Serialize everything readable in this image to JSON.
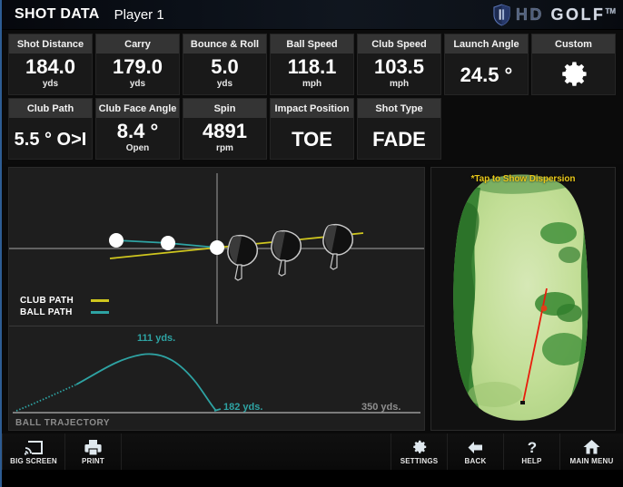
{
  "header": {
    "title": "SHOT DATA",
    "player": "Player 1",
    "logo_hd": "HD",
    "logo_golf": "GOLF",
    "logo_tm": "TM",
    "shield_icon": "shield-icon"
  },
  "stats": {
    "row1": [
      {
        "label": "Shot Distance",
        "value": "184.0",
        "unit": "yds"
      },
      {
        "label": "Carry",
        "value": "179.0",
        "unit": "yds"
      },
      {
        "label": "Bounce & Roll",
        "value": "5.0",
        "unit": "yds"
      },
      {
        "label": "Ball Speed",
        "value": "118.1",
        "unit": "mph"
      },
      {
        "label": "Club Speed",
        "value": "103.5",
        "unit": "mph"
      },
      {
        "label": "Launch Angle",
        "value": "24.5 °",
        "unit": ""
      },
      {
        "label": "Custom",
        "value": "",
        "unit": "",
        "icon": "gear-icon"
      }
    ],
    "row2": [
      {
        "label": "Club Path",
        "value": "5.5 ° O>I",
        "unit": ""
      },
      {
        "label": "Club Face Angle",
        "value": "8.4 °",
        "unit": "Open"
      },
      {
        "label": "Spin",
        "value": "4891",
        "unit": "rpm"
      },
      {
        "label": "Impact Position",
        "value": "TOE",
        "unit": ""
      },
      {
        "label": "Shot Type",
        "value": "FADE",
        "unit": ""
      }
    ]
  },
  "club_path_panel": {
    "legend": [
      {
        "label": "CLUB PATH",
        "color": "#cfc61e"
      },
      {
        "label": "BALL PATH",
        "color": "#2ea3a3"
      }
    ]
  },
  "chart_data": {
    "type": "line",
    "title": "BALL TRAJECTORY",
    "xlabel": "",
    "ylabel": "",
    "xlim": [
      0,
      350
    ],
    "ylim": [
      0,
      140
    ],
    "x_axis_end_label": "350 yds.",
    "series": [
      {
        "name": "Ball Trajectory",
        "color": "#2ea3a3",
        "x": [
          0,
          10,
          20,
          30,
          40,
          50,
          60,
          70,
          80,
          90,
          100,
          111,
          120,
          130,
          140,
          150,
          160,
          170,
          179,
          182
        ],
        "y": [
          0,
          14,
          26,
          38,
          48,
          57,
          65,
          72,
          78,
          83,
          86,
          88,
          87,
          84,
          78,
          68,
          53,
          33,
          6,
          3
        ]
      }
    ],
    "annotations": [
      {
        "text": "111 yds.",
        "x": 111,
        "y": 88,
        "color": "#2ea3a3",
        "meaning": "apex-height-label"
      },
      {
        "text": "182 yds.",
        "x": 182,
        "y": 3,
        "color": "#2ea3a3",
        "meaning": "landing-distance-label"
      }
    ],
    "grid": false,
    "legend_position": "none"
  },
  "green_view": {
    "tap_note": "*Tap to Show Dispersion",
    "shot_line_color": "#e81c0c",
    "green_color": "#b7d98a",
    "rough_color": "#2f7d2c"
  },
  "footer": {
    "left_buttons": [
      {
        "label": "BIG SCREEN",
        "icon": "cast-screen-icon"
      },
      {
        "label": "PRINT",
        "icon": "printer-icon"
      }
    ],
    "right_buttons": [
      {
        "label": "SETTINGS",
        "icon": "gear-icon"
      },
      {
        "label": "BACK",
        "icon": "arrow-left-icon"
      },
      {
        "label": "HELP",
        "icon": "question-mark-icon"
      },
      {
        "label": "MAIN MENU",
        "icon": "home-icon"
      }
    ]
  }
}
